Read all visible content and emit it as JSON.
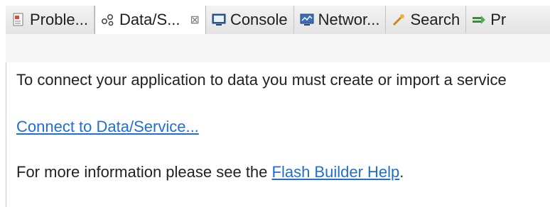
{
  "tabs": [
    {
      "label": "Proble...",
      "icon": "problems-icon"
    },
    {
      "label": "Data/S...",
      "icon": "data-services-icon",
      "active": true
    },
    {
      "label": "Console",
      "icon": "console-icon"
    },
    {
      "label": "Networ...",
      "icon": "network-monitor-icon"
    },
    {
      "label": "Search",
      "icon": "search-icon"
    },
    {
      "label": "Pr",
      "icon": "progress-icon"
    }
  ],
  "close_glyph": "⊠",
  "content": {
    "intro": "To connect your application to data you must create or import a service",
    "connect_link": "Connect to Data/Service...",
    "help_prefix": "For more information please see the ",
    "help_link": "Flash Builder Help",
    "help_suffix": "."
  },
  "colors": {
    "link": "#1f6fd1"
  }
}
